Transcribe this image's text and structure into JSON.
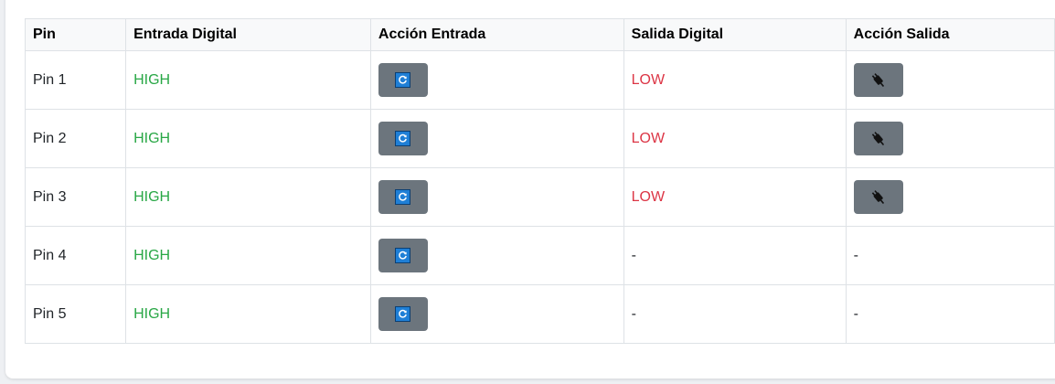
{
  "table": {
    "headers": [
      "Pin",
      "Entrada Digital",
      "Acción Entrada",
      "Salida Digital",
      "Acción Salida"
    ],
    "rows": [
      {
        "pin": "Pin 1",
        "input": "HIGH",
        "output": "LOW",
        "output_action": "plug-icon"
      },
      {
        "pin": "Pin 2",
        "input": "HIGH",
        "output": "LOW",
        "output_action": "plug-icon"
      },
      {
        "pin": "Pin 3",
        "input": "HIGH",
        "output": "LOW",
        "output_action": "plug-icon"
      },
      {
        "pin": "Pin 4",
        "input": "HIGH",
        "output": "-",
        "output_action": "-"
      },
      {
        "pin": "Pin 5",
        "input": "HIGH",
        "output": "-",
        "output_action": "-"
      }
    ]
  },
  "icons": {
    "input_action": "refresh-icon",
    "output_action": "plug-icon"
  },
  "colors": {
    "high": "#28a745",
    "low": "#dc3545",
    "button": "#6c757d",
    "refresh_icon": "#1f7fd6"
  }
}
